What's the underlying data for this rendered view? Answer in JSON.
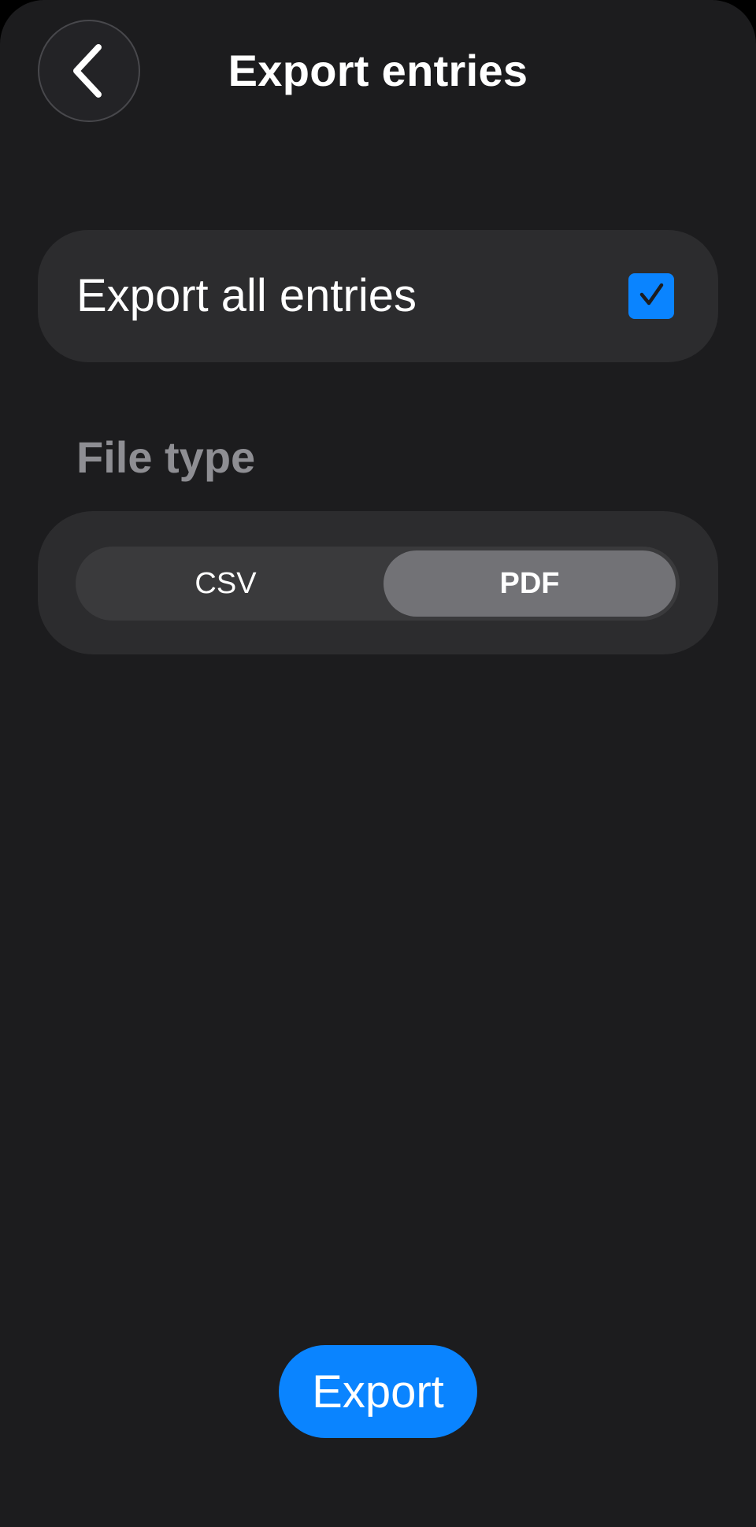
{
  "header": {
    "back_icon": "chevron-left-icon",
    "title": "Export entries"
  },
  "export_all": {
    "label": "Export all entries",
    "checked": true,
    "check_icon": "checkmark-icon"
  },
  "file_type": {
    "heading": "File type",
    "options": [
      "CSV",
      "PDF"
    ],
    "selected": "PDF"
  },
  "footer": {
    "export_label": "Export"
  },
  "colors": {
    "background": "#1c1c1e",
    "card": "#2c2c2e",
    "accent": "#0a84ff",
    "secondary_text": "#8e8e93"
  }
}
